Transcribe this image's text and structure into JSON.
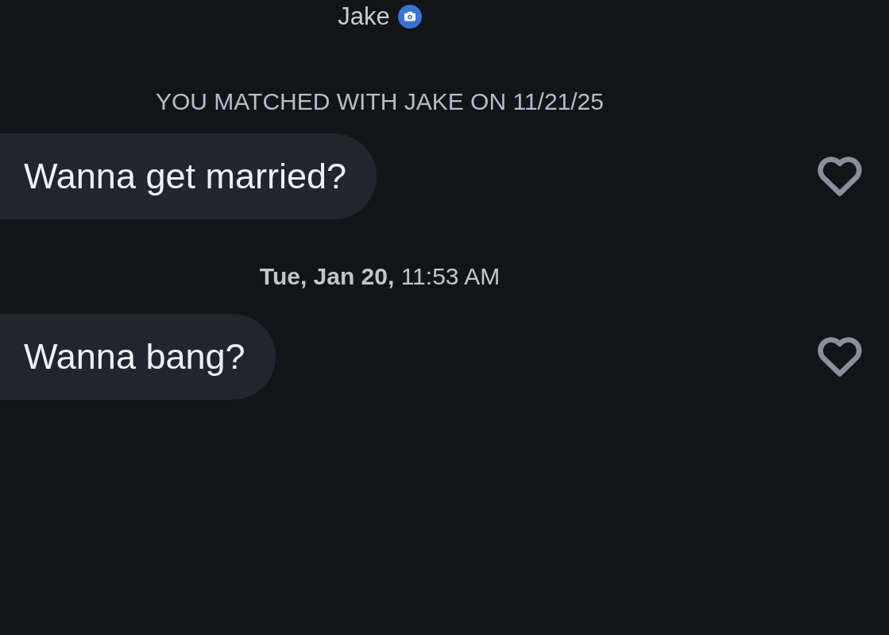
{
  "header": {
    "name": "Jake",
    "photo_verified": true
  },
  "match_notice": "YOU MATCHED WITH JAKE ON 11/21/25",
  "messages": [
    {
      "kind": "bubble",
      "text": "Wanna get married?",
      "liked": false
    },
    {
      "kind": "timestamp",
      "text": "**Tue, Jan 20,** 11:53 AM"
    },
    {
      "kind": "bubble",
      "text": "Wanna bang?",
      "liked": false
    }
  ]
}
